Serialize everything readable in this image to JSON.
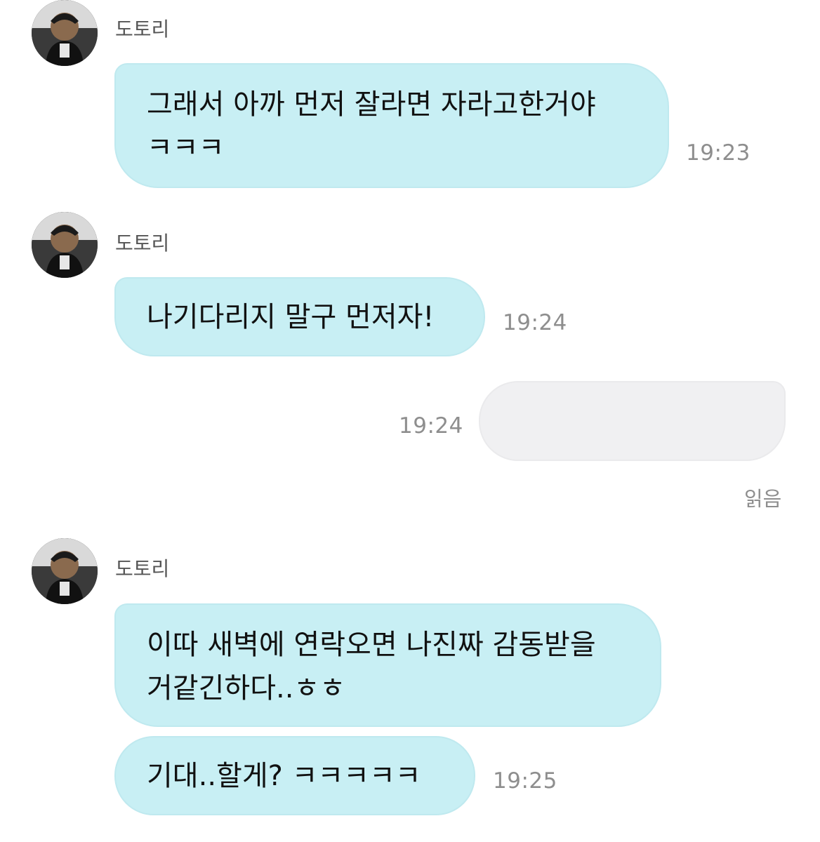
{
  "messages": [
    {
      "sender": "도토리",
      "lines": [
        "그래서 아까 먼저 잘라면 자라고한거야",
        "ㅋㅋㅋ"
      ],
      "time": "19:23"
    },
    {
      "sender": "도토리",
      "lines": [
        "나기다리지 말구 먼저자!"
      ],
      "time": "19:24"
    },
    {
      "mine": true,
      "lines": [
        ""
      ],
      "time": "19:24",
      "status": "읽음"
    },
    {
      "sender": "도토리",
      "lines": [
        "이따 새벽에 연락오면 나진짜 감동받을",
        "거같긴하다..ㅎㅎ"
      ]
    },
    {
      "lines": [
        "기대..할게? ㅋㅋㅋㅋㅋ"
      ],
      "time": "19:25"
    }
  ],
  "colors": {
    "received_bubble": "#c8eff4",
    "sent_bubble": "#f0f0f2",
    "timestamp": "#8e8e8e",
    "sender_name": "#555555"
  },
  "icons": {
    "avatar": "profile-photo-avatar"
  }
}
